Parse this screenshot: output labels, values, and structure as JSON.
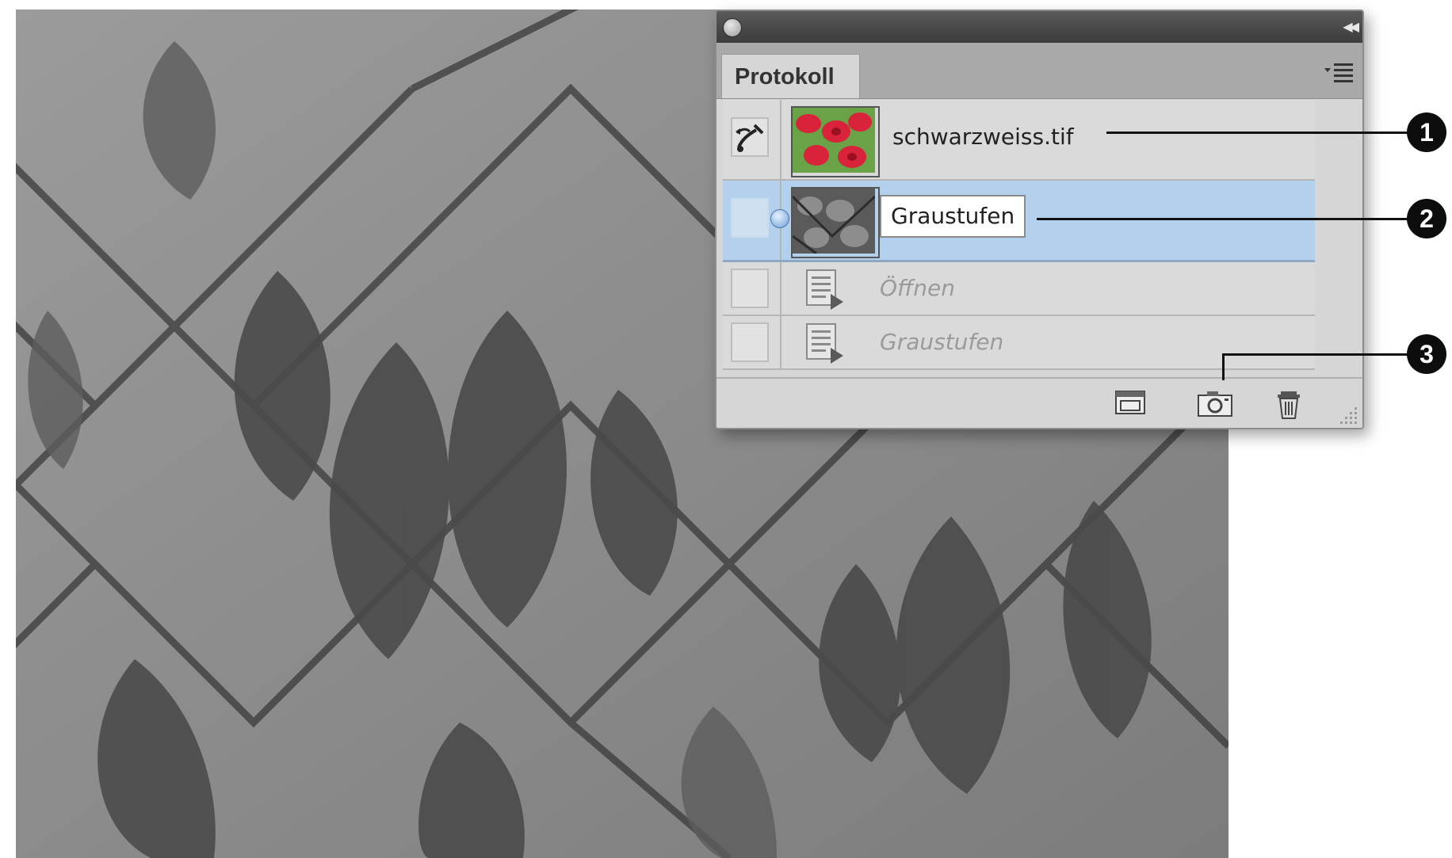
{
  "panel": {
    "tab_label": "Protokoll",
    "history": {
      "snapshots": [
        {
          "label": "schwarzweiss.tif",
          "thumb": "color-leaves-thumbnail",
          "source_brush_set": true
        },
        {
          "label": "Graustufen",
          "thumb": "grayscale-leaves-thumbnail",
          "selected": true,
          "renaming": true
        }
      ],
      "steps": [
        {
          "label": "Öffnen",
          "icon": "history-step-icon",
          "disabled": true
        },
        {
          "label": "Graustufen",
          "icon": "history-step-icon",
          "disabled": true
        }
      ]
    },
    "footer_buttons": [
      {
        "name": "new-document-from-state-button",
        "icon": "new-document-icon"
      },
      {
        "name": "create-snapshot-button",
        "icon": "camera-icon"
      },
      {
        "name": "delete-button",
        "icon": "trash-icon"
      }
    ]
  },
  "callouts": [
    "1",
    "2",
    "3"
  ],
  "colors": {
    "selection": "#b3d0ec",
    "panel": "#d6d6d6",
    "titlebar": "#4a4a4a"
  }
}
